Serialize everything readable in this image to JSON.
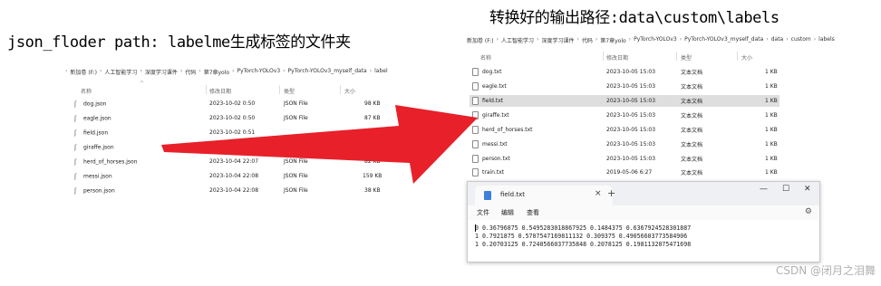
{
  "caption_left": "json_floder path: labelme生成标签的文件夹",
  "caption_right": "转换好的输出路径:data\\custom\\labels",
  "left_explorer": {
    "breadcrumb": [
      "新加卷 (F:)",
      "人工智能学习",
      "深度学习课件",
      "代码",
      "第7章yolo",
      "PyTorch-YOLOv3",
      "PyTorch-YOLOv3_myself_data",
      "label"
    ],
    "columns": {
      "name": "名称",
      "date": "修改日期",
      "type": "类型",
      "size": "大小"
    },
    "files": [
      {
        "name": "dog.json",
        "date": "2023-10-02 0:50",
        "type": "JSON File",
        "size": "98 KB"
      },
      {
        "name": "eagle.json",
        "date": "2023-10-02 0:50",
        "type": "JSON File",
        "size": "87 KB"
      },
      {
        "name": "field.json",
        "date": "2023-10-02 0:51",
        "type": "",
        "size": ""
      },
      {
        "name": "giraffe.json",
        "date": "",
        "type": "",
        "size": ""
      },
      {
        "name": "herd_of_horses.json",
        "date": "2023-10-04 22:07",
        "type": "JSON File",
        "size": "82 KB"
      },
      {
        "name": "messi.json",
        "date": "2023-10-04 22:08",
        "type": "JSON File",
        "size": "159 KB"
      },
      {
        "name": "person.json",
        "date": "2023-10-04 22:08",
        "type": "JSON File",
        "size": "38 KB"
      }
    ]
  },
  "right_explorer": {
    "breadcrumb": [
      "新加卷 (F:)",
      "人工智能学习",
      "深度学习课件",
      "代码",
      "第7章yolo",
      "PyTorch-YOLOv3",
      "PyTorch-YOLOv3_myself_data",
      "data",
      "custom",
      "labels"
    ],
    "columns": {
      "name": "名称",
      "date": "修改日期",
      "type": "类型",
      "size": "大小"
    },
    "files": [
      {
        "name": "dog.txt",
        "date": "2023-10-05 15:03",
        "type": "文本文档",
        "size": "1 KB"
      },
      {
        "name": "eagle.txt",
        "date": "2023-10-05 15:03",
        "type": "文本文档",
        "size": "1 KB"
      },
      {
        "name": "field.txt",
        "date": "2023-10-05 15:03",
        "type": "文本文档",
        "size": "1 KB"
      },
      {
        "name": "giraffe.txt",
        "date": "2023-10-05 15:03",
        "type": "文本文档",
        "size": "1 KB"
      },
      {
        "name": "herd_of_horses.txt",
        "date": "2023-10-05 15:03",
        "type": "文本文档",
        "size": "1 KB"
      },
      {
        "name": "messi.txt",
        "date": "2023-10-05 15:03",
        "type": "文本文档",
        "size": "1 KB"
      },
      {
        "name": "person.txt",
        "date": "2023-10-05 15:03",
        "type": "文本文档",
        "size": "1 KB"
      },
      {
        "name": "train.txt",
        "date": "2019-05-06 6:27",
        "type": "文本文档",
        "size": "1 KB"
      }
    ],
    "selected_file": "field.txt"
  },
  "notepad": {
    "tab_title": "field.txt",
    "tab_close": "×",
    "new_tab": "+",
    "controls": {
      "minimize": "—",
      "maximize": "☐",
      "close": "✕"
    },
    "menu": [
      "文件",
      "编辑",
      "查看"
    ],
    "settings_icon": "gear-icon",
    "lines": [
      "0 0.36796875 0.5495283018867925 0.1484375 0.6367924528301887",
      "1 0.7921875 0.5707547169811132 0.309375 0.49056603773584906",
      "1 0.20703125 0.7240566037735848 0.2078125 0.1981132075471698"
    ]
  },
  "arrow_color": "#e8202a",
  "watermark": "CSDN @闭月之泪舞"
}
